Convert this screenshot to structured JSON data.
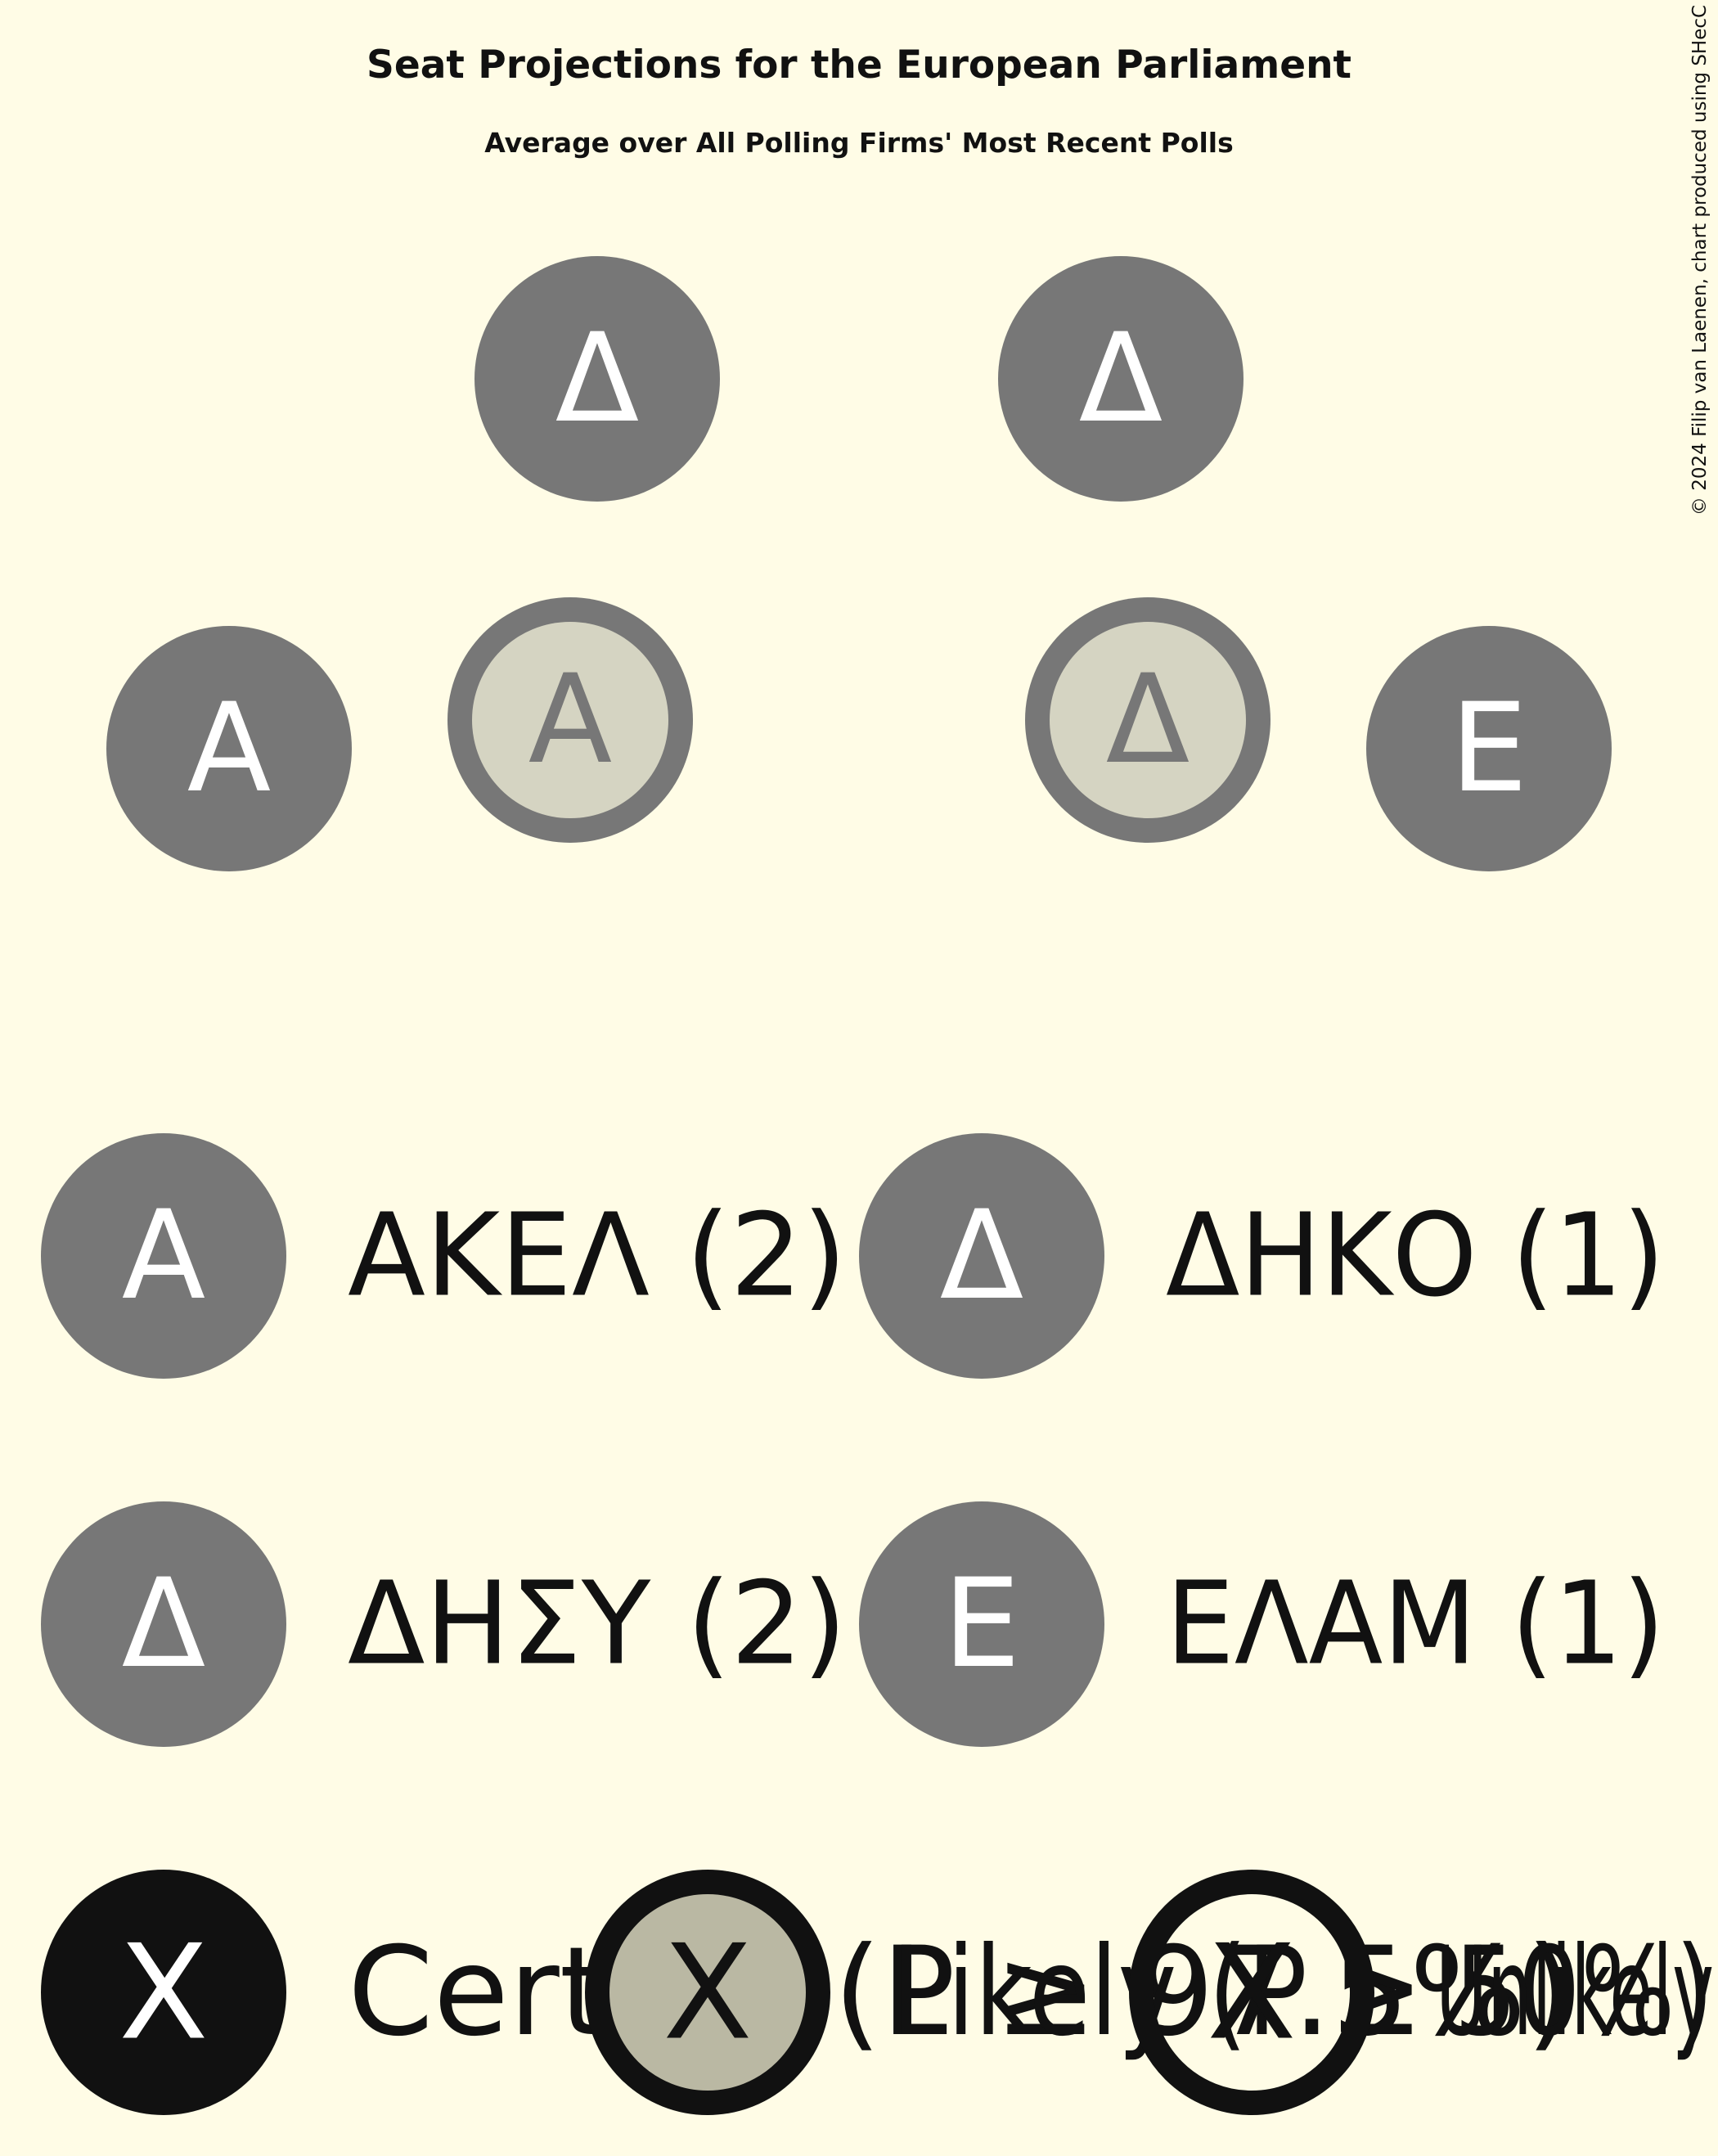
{
  "title": "Seat Projections for the European Parliament",
  "subtitle": "Average over All Polling Firms' Most Recent Polls",
  "copyright": "© 2024 Filip van Laenen, chart produced using SHecC",
  "colors": {
    "background": "#FFFCE6",
    "party_fill": "#777777",
    "likely_fill": "#D5D4C2",
    "certain_legend": "#111111",
    "likely_legend_fill": "#BAB8A3",
    "text_white": "#FFFFFF",
    "text_dark": "#111111"
  },
  "chart_data": {
    "type": "parliament-seats",
    "total_seats": 6,
    "seats": [
      {
        "letter": "Α",
        "party": "ΑΚΕΛ",
        "status": "certain"
      },
      {
        "letter": "Α",
        "party": "ΑΚΕΛ",
        "status": "likely"
      },
      {
        "letter": "Δ",
        "party": "ΔΗΣΥ",
        "status": "certain"
      },
      {
        "letter": "Δ",
        "party": "ΔΗΣΥ",
        "status": "likely"
      },
      {
        "letter": "Δ",
        "party": "ΔΗΚΟ",
        "status": "certain"
      },
      {
        "letter": "Ε",
        "party": "ΕΛΑΜ",
        "status": "certain"
      }
    ],
    "parties": [
      {
        "letter": "Α",
        "label": "ΑΚΕΛ (2)",
        "name": "ΑΚΕΛ",
        "seats": 2
      },
      {
        "letter": "Δ",
        "label": "ΔΗΚΟ (1)",
        "name": "ΔΗΚΟ",
        "seats": 1
      },
      {
        "letter": "Δ",
        "label": "ΔΗΣΥ (2)",
        "name": "ΔΗΣΥ",
        "seats": 2
      },
      {
        "letter": "Ε",
        "label": "ΕΛΑΜ (1)",
        "name": "ΕΛΑΜ",
        "seats": 1
      }
    ],
    "probability_legend": [
      {
        "symbol": "X",
        "style": "certain",
        "label": "Certain (P ≥ 97.5%)"
      },
      {
        "symbol": "X",
        "style": "likely",
        "label": "Likely (P ≥ 50%)"
      },
      {
        "symbol": "X",
        "style": "unlikely",
        "label": "Unlikely"
      }
    ]
  }
}
